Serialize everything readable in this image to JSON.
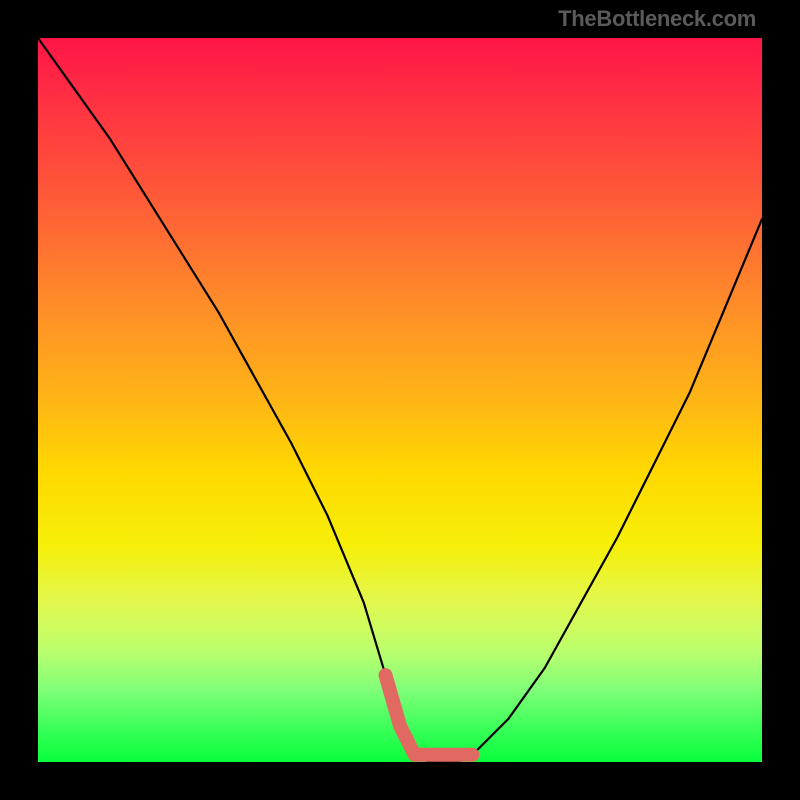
{
  "watermark": "TheBottleneck.com",
  "chart_data": {
    "type": "line",
    "title": "",
    "xlabel": "",
    "ylabel": "",
    "xlim": [
      0,
      100
    ],
    "ylim": [
      0,
      100
    ],
    "x": [
      0,
      5,
      10,
      15,
      20,
      25,
      30,
      35,
      40,
      45,
      48,
      50,
      52,
      54,
      56,
      58,
      60,
      65,
      70,
      75,
      80,
      85,
      90,
      95,
      100
    ],
    "y": [
      100,
      93,
      86,
      78,
      70,
      62,
      53,
      44,
      34,
      22,
      12,
      5,
      1,
      0,
      0,
      0,
      1,
      6,
      13,
      22,
      31,
      41,
      51,
      63,
      75
    ],
    "highlight_range_x": [
      48,
      60
    ],
    "highlight_y": 1,
    "gradient_stops": [
      {
        "pos": 0.0,
        "color": "#ff1547"
      },
      {
        "pos": 0.22,
        "color": "#ff5a38"
      },
      {
        "pos": 0.5,
        "color": "#ffb516"
      },
      {
        "pos": 0.7,
        "color": "#f6ef08"
      },
      {
        "pos": 0.9,
        "color": "#7fff78"
      },
      {
        "pos": 1.0,
        "color": "#08ff3d"
      }
    ]
  }
}
